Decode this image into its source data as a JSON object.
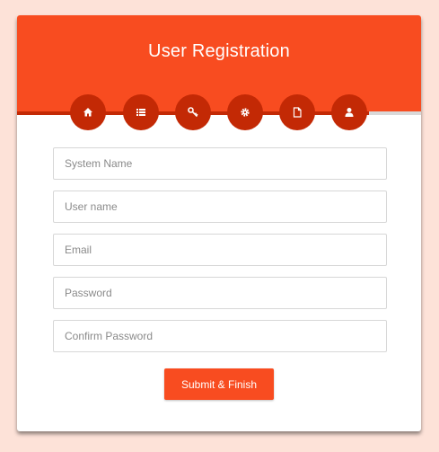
{
  "header": {
    "title": "User Registration"
  },
  "progress": {
    "fraction": 0.87
  },
  "steps": [
    {
      "icon": "home-icon"
    },
    {
      "icon": "list-icon"
    },
    {
      "icon": "key-icon"
    },
    {
      "icon": "gear-icon"
    },
    {
      "icon": "file-icon"
    },
    {
      "icon": "user-icon"
    }
  ],
  "form": {
    "system_name_placeholder": "System Name",
    "username_placeholder": "User name",
    "email_placeholder": "Email",
    "password_placeholder": "Password",
    "confirm_password_placeholder": "Confirm Password",
    "submit_label": "Submit & Finish"
  },
  "colors": {
    "page_background": "#fde2d8",
    "accent": "#f84c20",
    "step_active": "#c32905",
    "track": "#d9d9d9"
  }
}
